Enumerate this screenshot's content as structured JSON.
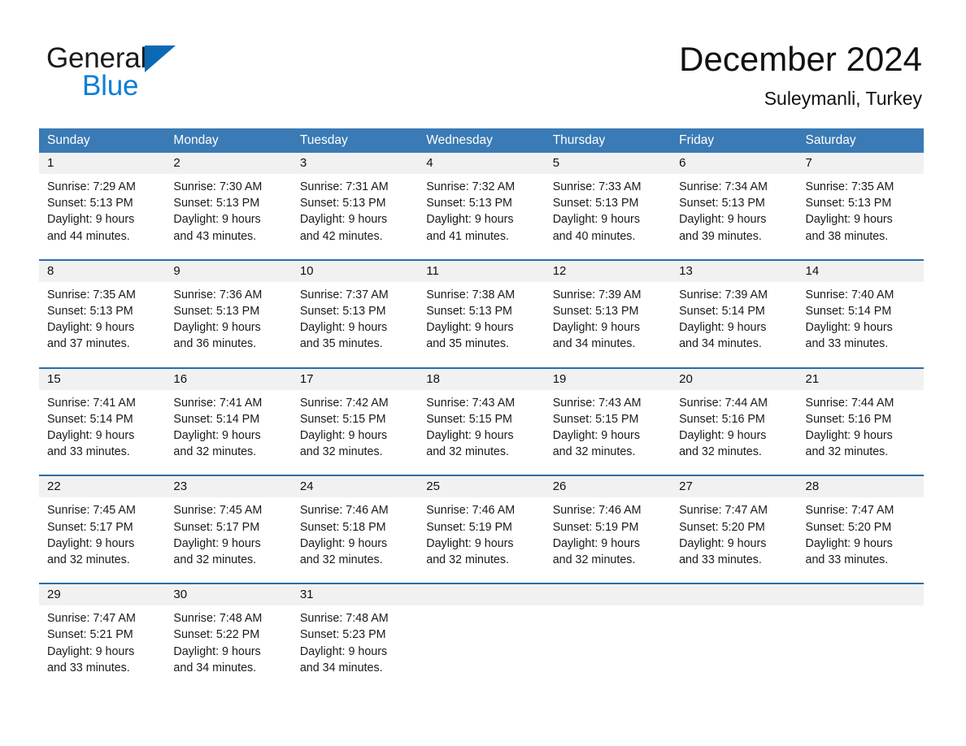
{
  "brand": {
    "name_part1": "General",
    "name_part2": "Blue",
    "triangle_color": "#0b69b4",
    "blue_color": "#0b7fd4"
  },
  "header": {
    "title": "December 2024",
    "subtitle": "Suleymanli, Turkey",
    "header_bg_color": "#3a7ab5",
    "rule_color": "#2e6da4",
    "daynum_bg_color": "#f1f1f1"
  },
  "weekday_headers": [
    "Sunday",
    "Monday",
    "Tuesday",
    "Wednesday",
    "Thursday",
    "Friday",
    "Saturday"
  ],
  "weeks": [
    {
      "days": [
        {
          "num": "1",
          "sunrise": "Sunrise: 7:29 AM",
          "sunset": "Sunset: 5:13 PM",
          "daylight1": "Daylight: 9 hours",
          "daylight2": "and 44 minutes."
        },
        {
          "num": "2",
          "sunrise": "Sunrise: 7:30 AM",
          "sunset": "Sunset: 5:13 PM",
          "daylight1": "Daylight: 9 hours",
          "daylight2": "and 43 minutes."
        },
        {
          "num": "3",
          "sunrise": "Sunrise: 7:31 AM",
          "sunset": "Sunset: 5:13 PM",
          "daylight1": "Daylight: 9 hours",
          "daylight2": "and 42 minutes."
        },
        {
          "num": "4",
          "sunrise": "Sunrise: 7:32 AM",
          "sunset": "Sunset: 5:13 PM",
          "daylight1": "Daylight: 9 hours",
          "daylight2": "and 41 minutes."
        },
        {
          "num": "5",
          "sunrise": "Sunrise: 7:33 AM",
          "sunset": "Sunset: 5:13 PM",
          "daylight1": "Daylight: 9 hours",
          "daylight2": "and 40 minutes."
        },
        {
          "num": "6",
          "sunrise": "Sunrise: 7:34 AM",
          "sunset": "Sunset: 5:13 PM",
          "daylight1": "Daylight: 9 hours",
          "daylight2": "and 39 minutes."
        },
        {
          "num": "7",
          "sunrise": "Sunrise: 7:35 AM",
          "sunset": "Sunset: 5:13 PM",
          "daylight1": "Daylight: 9 hours",
          "daylight2": "and 38 minutes."
        }
      ]
    },
    {
      "days": [
        {
          "num": "8",
          "sunrise": "Sunrise: 7:35 AM",
          "sunset": "Sunset: 5:13 PM",
          "daylight1": "Daylight: 9 hours",
          "daylight2": "and 37 minutes."
        },
        {
          "num": "9",
          "sunrise": "Sunrise: 7:36 AM",
          "sunset": "Sunset: 5:13 PM",
          "daylight1": "Daylight: 9 hours",
          "daylight2": "and 36 minutes."
        },
        {
          "num": "10",
          "sunrise": "Sunrise: 7:37 AM",
          "sunset": "Sunset: 5:13 PM",
          "daylight1": "Daylight: 9 hours",
          "daylight2": "and 35 minutes."
        },
        {
          "num": "11",
          "sunrise": "Sunrise: 7:38 AM",
          "sunset": "Sunset: 5:13 PM",
          "daylight1": "Daylight: 9 hours",
          "daylight2": "and 35 minutes."
        },
        {
          "num": "12",
          "sunrise": "Sunrise: 7:39 AM",
          "sunset": "Sunset: 5:13 PM",
          "daylight1": "Daylight: 9 hours",
          "daylight2": "and 34 minutes."
        },
        {
          "num": "13",
          "sunrise": "Sunrise: 7:39 AM",
          "sunset": "Sunset: 5:14 PM",
          "daylight1": "Daylight: 9 hours",
          "daylight2": "and 34 minutes."
        },
        {
          "num": "14",
          "sunrise": "Sunrise: 7:40 AM",
          "sunset": "Sunset: 5:14 PM",
          "daylight1": "Daylight: 9 hours",
          "daylight2": "and 33 minutes."
        }
      ]
    },
    {
      "days": [
        {
          "num": "15",
          "sunrise": "Sunrise: 7:41 AM",
          "sunset": "Sunset: 5:14 PM",
          "daylight1": "Daylight: 9 hours",
          "daylight2": "and 33 minutes."
        },
        {
          "num": "16",
          "sunrise": "Sunrise: 7:41 AM",
          "sunset": "Sunset: 5:14 PM",
          "daylight1": "Daylight: 9 hours",
          "daylight2": "and 32 minutes."
        },
        {
          "num": "17",
          "sunrise": "Sunrise: 7:42 AM",
          "sunset": "Sunset: 5:15 PM",
          "daylight1": "Daylight: 9 hours",
          "daylight2": "and 32 minutes."
        },
        {
          "num": "18",
          "sunrise": "Sunrise: 7:43 AM",
          "sunset": "Sunset: 5:15 PM",
          "daylight1": "Daylight: 9 hours",
          "daylight2": "and 32 minutes."
        },
        {
          "num": "19",
          "sunrise": "Sunrise: 7:43 AM",
          "sunset": "Sunset: 5:15 PM",
          "daylight1": "Daylight: 9 hours",
          "daylight2": "and 32 minutes."
        },
        {
          "num": "20",
          "sunrise": "Sunrise: 7:44 AM",
          "sunset": "Sunset: 5:16 PM",
          "daylight1": "Daylight: 9 hours",
          "daylight2": "and 32 minutes."
        },
        {
          "num": "21",
          "sunrise": "Sunrise: 7:44 AM",
          "sunset": "Sunset: 5:16 PM",
          "daylight1": "Daylight: 9 hours",
          "daylight2": "and 32 minutes."
        }
      ]
    },
    {
      "days": [
        {
          "num": "22",
          "sunrise": "Sunrise: 7:45 AM",
          "sunset": "Sunset: 5:17 PM",
          "daylight1": "Daylight: 9 hours",
          "daylight2": "and 32 minutes."
        },
        {
          "num": "23",
          "sunrise": "Sunrise: 7:45 AM",
          "sunset": "Sunset: 5:17 PM",
          "daylight1": "Daylight: 9 hours",
          "daylight2": "and 32 minutes."
        },
        {
          "num": "24",
          "sunrise": "Sunrise: 7:46 AM",
          "sunset": "Sunset: 5:18 PM",
          "daylight1": "Daylight: 9 hours",
          "daylight2": "and 32 minutes."
        },
        {
          "num": "25",
          "sunrise": "Sunrise: 7:46 AM",
          "sunset": "Sunset: 5:19 PM",
          "daylight1": "Daylight: 9 hours",
          "daylight2": "and 32 minutes."
        },
        {
          "num": "26",
          "sunrise": "Sunrise: 7:46 AM",
          "sunset": "Sunset: 5:19 PM",
          "daylight1": "Daylight: 9 hours",
          "daylight2": "and 32 minutes."
        },
        {
          "num": "27",
          "sunrise": "Sunrise: 7:47 AM",
          "sunset": "Sunset: 5:20 PM",
          "daylight1": "Daylight: 9 hours",
          "daylight2": "and 33 minutes."
        },
        {
          "num": "28",
          "sunrise": "Sunrise: 7:47 AM",
          "sunset": "Sunset: 5:20 PM",
          "daylight1": "Daylight: 9 hours",
          "daylight2": "and 33 minutes."
        }
      ]
    },
    {
      "days": [
        {
          "num": "29",
          "sunrise": "Sunrise: 7:47 AM",
          "sunset": "Sunset: 5:21 PM",
          "daylight1": "Daylight: 9 hours",
          "daylight2": "and 33 minutes."
        },
        {
          "num": "30",
          "sunrise": "Sunrise: 7:48 AM",
          "sunset": "Sunset: 5:22 PM",
          "daylight1": "Daylight: 9 hours",
          "daylight2": "and 34 minutes."
        },
        {
          "num": "31",
          "sunrise": "Sunrise: 7:48 AM",
          "sunset": "Sunset: 5:23 PM",
          "daylight1": "Daylight: 9 hours",
          "daylight2": "and 34 minutes."
        },
        {
          "num": "",
          "sunrise": "",
          "sunset": "",
          "daylight1": "",
          "daylight2": ""
        },
        {
          "num": "",
          "sunrise": "",
          "sunset": "",
          "daylight1": "",
          "daylight2": ""
        },
        {
          "num": "",
          "sunrise": "",
          "sunset": "",
          "daylight1": "",
          "daylight2": ""
        },
        {
          "num": "",
          "sunrise": "",
          "sunset": "",
          "daylight1": "",
          "daylight2": ""
        }
      ]
    }
  ]
}
